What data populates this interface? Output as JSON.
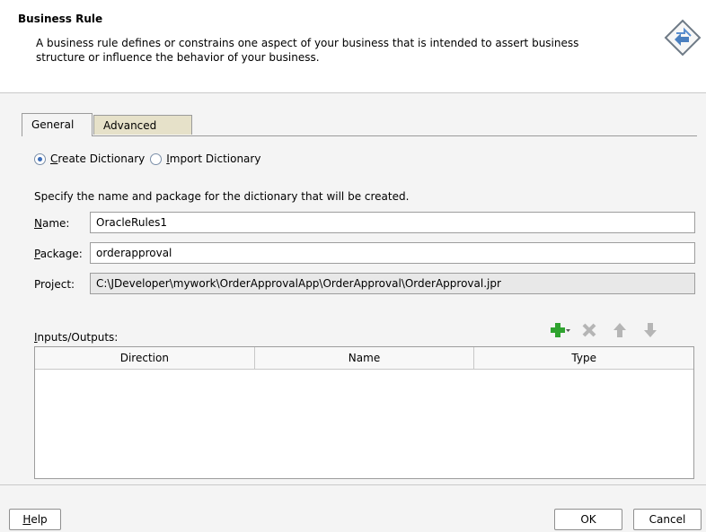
{
  "header": {
    "title": "Business Rule",
    "description": "A business rule defines or constrains one aspect of your business that is intended to assert business structure or influence the behavior of your business.",
    "icon": "business-rule-diamond-icon"
  },
  "tabs": [
    {
      "label": "General",
      "active": true
    },
    {
      "label": "Advanced",
      "active": false
    }
  ],
  "dictionary_mode": {
    "create_label_mnemonic": "C",
    "create_label_rest": "reate Dictionary",
    "import_label_mnemonic": "I",
    "import_label_rest": "mport Dictionary",
    "selected": "create"
  },
  "hint": "Specify the name and package for the dictionary that will be created.",
  "fields": {
    "name_label_mnemonic": "N",
    "name_label_rest": "ame:",
    "name_value": "OracleRules1",
    "package_label_mnemonic": "P",
    "package_label_rest": "ackage:",
    "package_value": "orderapproval",
    "project_label": "Project:",
    "project_value": "C:\\JDeveloper\\mywork\\OrderApprovalApp\\OrderApproval\\OrderApproval.jpr"
  },
  "io": {
    "label_mnemonic": "I",
    "label_rest": "nputs/Outputs:",
    "columns": [
      "Direction",
      "Name",
      "Type"
    ],
    "rows": [],
    "tools": [
      "add-icon",
      "delete-icon",
      "move-up-icon",
      "move-down-icon"
    ]
  },
  "footer": {
    "help_mnemonic": "H",
    "help_rest": "elp",
    "ok": "OK",
    "cancel": "Cancel"
  },
  "colors": {
    "add_green": "#2fa32f",
    "disabled_gray": "#b5b5b5",
    "tab_inactive": "#e6e1c9"
  }
}
